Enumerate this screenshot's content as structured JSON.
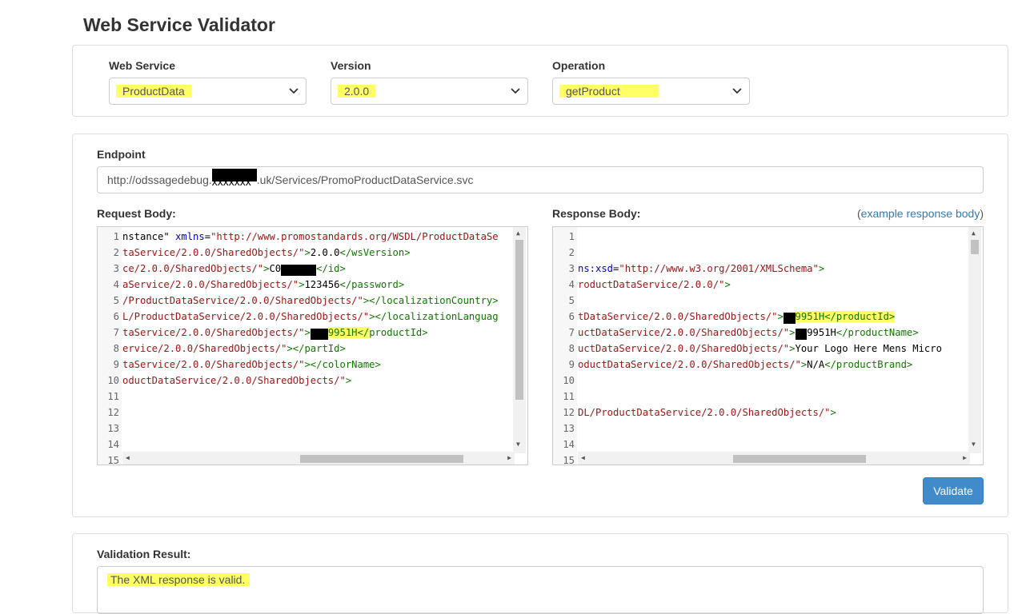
{
  "page": {
    "title": "Web Service Validator"
  },
  "selection": {
    "web_service": {
      "label": "Web Service",
      "value": "ProductData"
    },
    "version": {
      "label": "Version",
      "value": "2.0.0"
    },
    "operation": {
      "label": "Operation",
      "value": "getProduct"
    }
  },
  "endpoint": {
    "label": "Endpoint",
    "value_prefix": "http://odssagedebug.",
    "redacted": "xxxxxxx",
    "value_suffix": ".uk/Services/PromoProductDataService.svc"
  },
  "request": {
    "label": "Request Body:",
    "line_numbers": [
      "1",
      "2",
      "3",
      "4",
      "5",
      "6",
      "7",
      "8",
      "9",
      "10",
      "11",
      "12",
      "13",
      "14",
      "15"
    ],
    "lines": [
      {
        "n": "1",
        "tokens": [
          [
            "txt",
            "nstance\" "
          ],
          [
            "attr",
            "xmlns"
          ],
          [
            "txt",
            "="
          ],
          [
            "str",
            "\"http://www.promostandards.org/WSDL/ProductDataSe"
          ]
        ]
      },
      {
        "n": "2",
        "tokens": [
          [
            "str",
            "taService/2.0.0/SharedObjects/\""
          ],
          [
            "tag",
            ">"
          ],
          [
            "txt",
            "2.0.0"
          ],
          [
            "tag",
            "</wsVersion>"
          ]
        ]
      },
      {
        "n": "3",
        "tokens": [
          [
            "str",
            "ce/2.0.0/SharedObjects/\""
          ],
          [
            "tag",
            ">"
          ],
          [
            "txt",
            "C0"
          ],
          [
            "red",
            "XXXXXX"
          ],
          [
            "tag",
            "</id>"
          ]
        ]
      },
      {
        "n": "4",
        "tokens": [
          [
            "str",
            "aService/2.0.0/SharedObjects/\""
          ],
          [
            "tag",
            ">"
          ],
          [
            "txt",
            "123456"
          ],
          [
            "tag",
            "</password>"
          ]
        ]
      },
      {
        "n": "5",
        "tokens": [
          [
            "str",
            "/ProductDataService/2.0.0/SharedObjects/\""
          ],
          [
            "tag",
            "></localizationCountry>"
          ]
        ]
      },
      {
        "n": "6",
        "tokens": [
          [
            "str",
            "L/ProductDataService/2.0.0/SharedObjects/\""
          ],
          [
            "tag",
            "></localizationLanguag"
          ]
        ]
      },
      {
        "n": "7",
        "tokens": [
          [
            "str",
            "taService/2.0.0/SharedObjects/\""
          ],
          [
            "tag",
            ">"
          ],
          [
            "red",
            "XXX"
          ],
          [
            "hl",
            "9951H</"
          ],
          [
            "tag",
            "productId>"
          ]
        ]
      },
      {
        "n": "8",
        "tokens": [
          [
            "str",
            "ervice/2.0.0/SharedObjects/\""
          ],
          [
            "tag",
            "></partId>"
          ]
        ]
      },
      {
        "n": "9",
        "tokens": [
          [
            "str",
            "taService/2.0.0/SharedObjects/\""
          ],
          [
            "tag",
            "></colorName>"
          ]
        ]
      },
      {
        "n": "10",
        "tokens": [
          [
            "str",
            "oductDataService/2.0.0/SharedObjects/\""
          ],
          [
            "tag",
            ">"
          ]
        ]
      }
    ]
  },
  "response": {
    "label": "Response Body:",
    "example_prefix": "(",
    "example_link": "example response body",
    "example_suffix": ")",
    "line_numbers": [
      "1",
      "2",
      "3",
      "4",
      "5",
      "6",
      "7",
      "8",
      "9",
      "10",
      "11",
      "12",
      "13",
      "14",
      "15"
    ],
    "lines": [
      {
        "n": "3",
        "tokens": [
          [
            "attr",
            "ns:xsd"
          ],
          [
            "txt",
            "="
          ],
          [
            "str",
            "\"http://www.w3.org/2001/XMLSchema\""
          ],
          [
            "tag",
            ">"
          ]
        ]
      },
      {
        "n": "4",
        "tokens": [
          [
            "str",
            "roductDataService/2.0.0/\""
          ],
          [
            "tag",
            ">"
          ]
        ]
      },
      {
        "n": "6",
        "tokens": [
          [
            "str",
            "tDataService/2.0.0/SharedObjects/\""
          ],
          [
            "tag",
            ">"
          ],
          [
            "red",
            "XX"
          ],
          [
            "hl",
            "9951H</productId>"
          ]
        ]
      },
      {
        "n": "7",
        "tokens": [
          [
            "str",
            "uctDataService/2.0.0/SharedObjects/\""
          ],
          [
            "tag",
            ">"
          ],
          [
            "red",
            "XX"
          ],
          [
            "txt",
            "9951H"
          ],
          [
            "tag",
            "</productName>"
          ]
        ]
      },
      {
        "n": "8",
        "tokens": [
          [
            "str",
            "uctDataService/2.0.0/SharedObjects/\""
          ],
          [
            "tag",
            ">"
          ],
          [
            "txt",
            "Your Logo Here Mens Micro"
          ]
        ]
      },
      {
        "n": "9",
        "tokens": [
          [
            "str",
            "oductDataService/2.0.0/SharedObjects/\""
          ],
          [
            "tag",
            ">"
          ],
          [
            "txt",
            "N/A"
          ],
          [
            "tag",
            "</productBrand>"
          ]
        ]
      },
      {
        "n": "12",
        "tokens": [
          [
            "str",
            "DL/ProductDataService/2.0.0/SharedObjects/\""
          ],
          [
            "tag",
            ">"
          ]
        ]
      }
    ]
  },
  "actions": {
    "validate_label": "Validate"
  },
  "result": {
    "label": "Validation Result:",
    "message": "The XML response is valid."
  },
  "colors": {
    "highlight": "#ffff66",
    "primary_button": "#428bca",
    "link": "#337ab7"
  },
  "icons": [
    "chevron-down-icon",
    "scroll-arrow-up-icon",
    "scroll-arrow-down-icon",
    "scroll-arrow-left-icon",
    "scroll-arrow-right-icon"
  ]
}
